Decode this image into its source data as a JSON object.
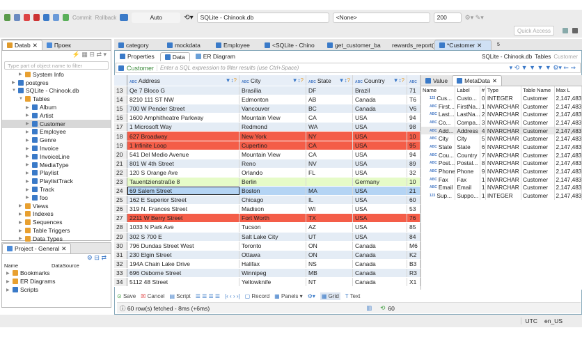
{
  "toolbar": {
    "commit": "Commit",
    "rollback": "Rollback",
    "mode": "Auto",
    "datasource": "SQLite - Chinook.db",
    "schema": "<None>",
    "limit": "200",
    "quick_access": "Quick Access"
  },
  "left_panel": {
    "tabs": [
      "Datab",
      "Проек"
    ],
    "filter_placeholder": "Type part of object name to filter",
    "tree": [
      {
        "label": "System Info",
        "level": 2,
        "icon": "folder"
      },
      {
        "label": "postgres",
        "level": 1,
        "icon": "db"
      },
      {
        "label": "SQLite - Chinook.db",
        "level": 1,
        "icon": "db",
        "open": true
      },
      {
        "label": "Tables",
        "level": 2,
        "icon": "folder",
        "open": true
      },
      {
        "label": "Album",
        "level": 3,
        "icon": "table"
      },
      {
        "label": "Artist",
        "level": 3,
        "icon": "table"
      },
      {
        "label": "Customer",
        "level": 3,
        "icon": "table",
        "selected": true
      },
      {
        "label": "Employee",
        "level": 3,
        "icon": "table"
      },
      {
        "label": "Genre",
        "level": 3,
        "icon": "table"
      },
      {
        "label": "Invoice",
        "level": 3,
        "icon": "table"
      },
      {
        "label": "InvoiceLine",
        "level": 3,
        "icon": "table"
      },
      {
        "label": "MediaType",
        "level": 3,
        "icon": "table"
      },
      {
        "label": "Playlist",
        "level": 3,
        "icon": "table"
      },
      {
        "label": "PlaylistTrack",
        "level": 3,
        "icon": "table"
      },
      {
        "label": "Track",
        "level": 3,
        "icon": "table"
      },
      {
        "label": "foo",
        "level": 3,
        "icon": "table"
      },
      {
        "label": "Views",
        "level": 2,
        "icon": "folder"
      },
      {
        "label": "Indexes",
        "level": 2,
        "icon": "folder"
      },
      {
        "label": "Sequences",
        "level": 2,
        "icon": "folder"
      },
      {
        "label": "Table Triggers",
        "level": 2,
        "icon": "folder"
      },
      {
        "label": "Data Types",
        "level": 2,
        "icon": "folder"
      }
    ]
  },
  "project_panel": {
    "title": "Project - General",
    "col_name": "Name",
    "col_datasource": "DataSource",
    "items": [
      "Bookmarks",
      "ER Diagrams",
      "Scripts"
    ]
  },
  "editor_tabs": [
    "category",
    "mockdata",
    "Employee",
    "<SQLite - Chino",
    "get_customer_ba",
    "rewards_report(",
    "*Customer"
  ],
  "overflow_count": "5",
  "sub_tabs": [
    "Properties",
    "Data",
    "ER Diagram"
  ],
  "breadcrumb": {
    "datasource": "SQLite - Chinook.db",
    "folder": "Tables",
    "table": "Customer"
  },
  "filter": {
    "table": "Customer",
    "placeholder": "Enter a SQL expression to filter results (use Ctrl+Space)"
  },
  "grid": {
    "columns": [
      "Address",
      "City",
      "State",
      "Country",
      ""
    ],
    "rows": [
      [
        "13",
        "Qe 7 Bloco G",
        "Brasília",
        "DF",
        "Brazil",
        "71",
        "even"
      ],
      [
        "14",
        "8210 111 ST NW",
        "Edmonton",
        "AB",
        "Canada",
        "T6",
        "odd"
      ],
      [
        "15",
        "700 W Pender Street",
        "Vancouver",
        "BC",
        "Canada",
        "V6",
        "even"
      ],
      [
        "16",
        "1600 Amphitheatre Parkway",
        "Mountain View",
        "CA",
        "USA",
        "94",
        "odd"
      ],
      [
        "17",
        "1 Microsoft Way",
        "Redmond",
        "WA",
        "USA",
        "98",
        "even"
      ],
      [
        "18",
        "627 Broadway",
        "New York",
        "NY",
        "USA",
        "10",
        "red"
      ],
      [
        "19",
        "1 Infinite Loop",
        "Cupertino",
        "CA",
        "USA",
        "95",
        "red"
      ],
      [
        "20",
        "541 Del Medio Avenue",
        "Mountain View",
        "CA",
        "USA",
        "94",
        "odd"
      ],
      [
        "21",
        "801 W 4th Street",
        "Reno",
        "NV",
        "USA",
        "89",
        "even"
      ],
      [
        "22",
        "120 S Orange Ave",
        "Orlando",
        "FL",
        "USA",
        "32",
        "odd"
      ],
      [
        "23",
        "Tauentzienstraße 8",
        "Berlin",
        "",
        "Germany",
        "10",
        "green"
      ],
      [
        "24",
        "69 Salem Street",
        "Boston",
        "MA",
        "USA",
        "21",
        "blue"
      ],
      [
        "25",
        "162 E Superior Street",
        "Chicago",
        "IL",
        "USA",
        "60",
        "even"
      ],
      [
        "26",
        "319 N. Frances Street",
        "Madison",
        "WI",
        "USA",
        "53",
        "odd"
      ],
      [
        "27",
        "2211 W Berry Street",
        "Fort Worth",
        "TX",
        "USA",
        "76",
        "red"
      ],
      [
        "28",
        "1033 N Park Ave",
        "Tucson",
        "AZ",
        "USA",
        "85",
        "odd"
      ],
      [
        "29",
        "302 S 700 E",
        "Salt Lake City",
        "UT",
        "USA",
        "84",
        "even"
      ],
      [
        "30",
        "796 Dundas Street West",
        "Toronto",
        "ON",
        "Canada",
        "M6",
        "odd"
      ],
      [
        "31",
        "230 Elgin Street",
        "Ottawa",
        "ON",
        "Canada",
        "K2",
        "even"
      ],
      [
        "32",
        "194A Chain Lake Drive",
        "Halifax",
        "NS",
        "Canada",
        "B3",
        "odd"
      ],
      [
        "33",
        "696 Osborne Street",
        "Winnipeg",
        "MB",
        "Canada",
        "R3",
        "even"
      ],
      [
        "34",
        "5112 48 Street",
        "Yellowknife",
        "NT",
        "Canada",
        "X1",
        "odd"
      ]
    ]
  },
  "side_tabs": [
    "Value",
    "MetaData"
  ],
  "metadata": {
    "columns": [
      "Name",
      "Label",
      "#",
      "Type",
      "Table Name",
      "Max L"
    ],
    "rows": [
      [
        "123",
        "Cus...",
        "Custo...",
        "0",
        "INTEGER",
        "Customer",
        "2,147,483"
      ],
      [
        "ABC",
        "First...",
        "FirstNa...",
        "1",
        "NVARCHAR",
        "Customer",
        "2,147,483"
      ],
      [
        "ABC",
        "Last...",
        "LastNa...",
        "2",
        "NVARCHAR",
        "Customer",
        "2,147,483"
      ],
      [
        "ABC",
        "Co...",
        "Compa...",
        "3",
        "NVARCHAR",
        "Customer",
        "2,147,483"
      ],
      [
        "ABC",
        "Add...",
        "Address",
        "4",
        "NVARCHAR",
        "Customer",
        "2,147,483"
      ],
      [
        "ABC",
        "City",
        "City",
        "5",
        "NVARCHAR",
        "Customer",
        "2,147,483"
      ],
      [
        "ABC",
        "State",
        "State",
        "6",
        "NVARCHAR",
        "Customer",
        "2,147,483"
      ],
      [
        "ABC",
        "Cou...",
        "Country",
        "7",
        "NVARCHAR",
        "Customer",
        "2,147,483"
      ],
      [
        "ABC",
        "Post...",
        "Postal...",
        "8",
        "NVARCHAR",
        "Customer",
        "2,147,483"
      ],
      [
        "ABC",
        "Phone",
        "Phone",
        "9",
        "NVARCHAR",
        "Customer",
        "2,147,483"
      ],
      [
        "ABC",
        "Fax",
        "Fax",
        "1",
        "NVARCHAR",
        "Customer",
        "2,147,483"
      ],
      [
        "ABC",
        "Email",
        "Email",
        "1",
        "NVARCHAR",
        "Customer",
        "2,147,483"
      ],
      [
        "123",
        "Sup...",
        "Suppo...",
        "1",
        "INTEGER",
        "Customer",
        "2,147,483"
      ]
    ]
  },
  "bottom_toolbar": {
    "save": "Save",
    "cancel": "Cancel",
    "script": "Script",
    "record": "Record",
    "panels": "Panels",
    "grid": "Grid",
    "text": "Text"
  },
  "status": {
    "message": "60 row(s) fetched - 8ms (+6ms)",
    "count": "60"
  },
  "statusbar": {
    "timezone": "UTC",
    "locale": "en_US"
  }
}
